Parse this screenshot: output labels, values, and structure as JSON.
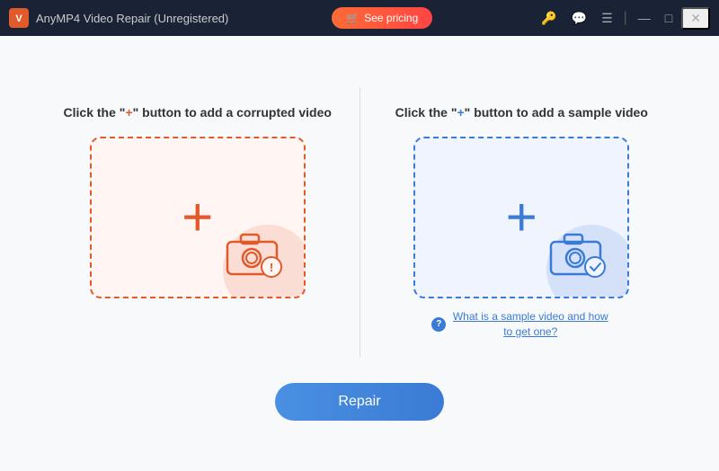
{
  "titleBar": {
    "logo": "V",
    "title": "AnyMP4 Video Repair (Unregistered)",
    "seePricingLabel": "See pricing",
    "icons": {
      "key": "🔑",
      "chat": "💬",
      "menu": "☰",
      "minimize": "—",
      "maximize": "□",
      "close": "✕"
    }
  },
  "leftPanel": {
    "labelPart1": "Click the \"",
    "labelPlus": "+",
    "labelPart2": "\" button to add a corrupted video",
    "plusSymbol": "+",
    "color": "red"
  },
  "rightPanel": {
    "labelPart1": "Click the \"",
    "labelPlus": "+",
    "labelPart2": "\" button to add a sample video",
    "plusSymbol": "+",
    "color": "blue",
    "helpText": "What is a sample video and how to get one?"
  },
  "repairButton": {
    "label": "Repair"
  }
}
